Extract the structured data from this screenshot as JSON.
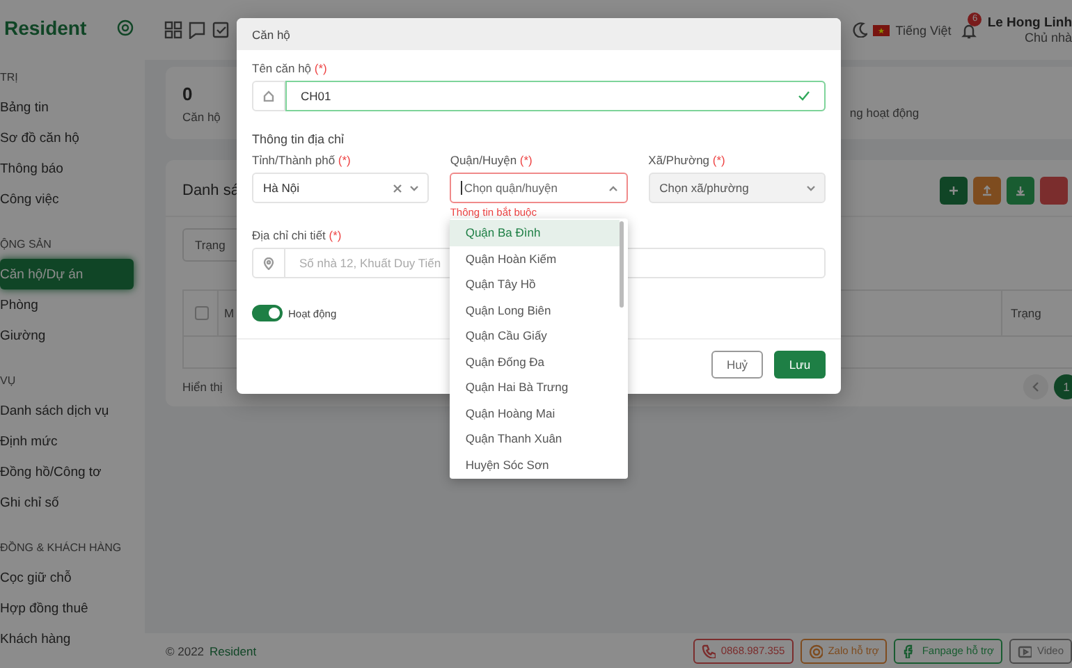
{
  "sidebar": {
    "logo": "Resident",
    "sections": [
      {
        "title": "TRỊ",
        "items": [
          {
            "label": "Bảng tin",
            "selected": false
          },
          {
            "label": "Sơ đồ căn hộ",
            "selected": false
          },
          {
            "label": "Thông báo",
            "selected": false
          },
          {
            "label": "Công việc",
            "selected": false
          }
        ]
      },
      {
        "title": "ỘNG SẢN",
        "items": [
          {
            "label": "Căn hộ/Dự án",
            "selected": true
          },
          {
            "label": "Phòng",
            "selected": false
          },
          {
            "label": "Giường",
            "selected": false
          }
        ]
      },
      {
        "title": "VỤ",
        "items": [
          {
            "label": "Danh sách dịch vụ",
            "selected": false
          },
          {
            "label": "Định mức",
            "selected": false
          },
          {
            "label": "Đồng hồ/Công tơ",
            "selected": false
          },
          {
            "label": "Ghi chỉ số",
            "selected": false
          }
        ]
      },
      {
        "title": "ĐỒNG & KHÁCH HÀNG",
        "items": [
          {
            "label": "Cọc giữ chỗ",
            "selected": false
          },
          {
            "label": "Hợp đồng thuê",
            "selected": false
          },
          {
            "label": "Khách hàng",
            "selected": false
          }
        ]
      }
    ]
  },
  "header": {
    "language": "Tiếng Việt",
    "notification_count": "6",
    "user_name": "Le Hong Linh",
    "user_role": "Chủ nhà"
  },
  "stats": {
    "value": "0",
    "label": "Căn hộ",
    "partial_label": "ng hoạt động"
  },
  "list": {
    "title": "Danh sá",
    "filter": "Trạng",
    "select_all_checked": false,
    "columns": [
      "M",
      "Trạng"
    ],
    "footer_text": "Hiển thị",
    "pagination": [
      {
        "label": "1",
        "selected": true
      }
    ]
  },
  "footer": {
    "copyright": "© 2022",
    "brand": "Resident",
    "buttons": [
      {
        "kind": "phone",
        "label": "0868.987.355"
      },
      {
        "kind": "zalo",
        "label": "Zalo hỗ trợ"
      },
      {
        "kind": "fanpage",
        "label": "Fanpage hỗ trợ"
      },
      {
        "kind": "video",
        "label": "Video"
      }
    ]
  },
  "modal": {
    "title": "Căn hộ",
    "name_field": {
      "label": "Tên căn hộ",
      "required_mark": "(*)",
      "value": "CH01",
      "valid": true
    },
    "address_title": "Thông tin địa chỉ",
    "selects": [
      {
        "label": "Tỉnh/Thành phố",
        "required_mark": "(*)",
        "value": "Hà Nội",
        "clearable": true,
        "open": false,
        "error": false,
        "disabled": false
      },
      {
        "label": "Quận/Huyện",
        "required_mark": "(*)",
        "placeholder": "Chọn quận/huyện",
        "clearable": false,
        "open": true,
        "error": true,
        "error_text": "Thông tin bắt buộc",
        "disabled": false,
        "options": [
          {
            "label": "Quận Ba Đình",
            "selected": true
          },
          {
            "label": "Quận Hoàn Kiếm",
            "selected": false
          },
          {
            "label": "Quận Tây Hồ",
            "selected": false
          },
          {
            "label": "Quận Long Biên",
            "selected": false
          },
          {
            "label": "Quận Cầu Giấy",
            "selected": false
          },
          {
            "label": "Quận Đống Đa",
            "selected": false
          },
          {
            "label": "Quận Hai Bà Trưng",
            "selected": false
          },
          {
            "label": "Quận Hoàng Mai",
            "selected": false
          },
          {
            "label": "Quận Thanh Xuân",
            "selected": false
          },
          {
            "label": "Huyện Sóc Sơn",
            "selected": false
          }
        ]
      },
      {
        "label": "Xã/Phường",
        "required_mark": "(*)",
        "placeholder": "Chọn xã/phường",
        "clearable": false,
        "open": false,
        "error": false,
        "disabled": true
      }
    ],
    "address_field": {
      "label": "Địa chỉ chi tiết",
      "required_mark": "(*)",
      "placeholder": "Số nhà 12, Khuất Duy Tiến"
    },
    "active_toggle": {
      "label": "Hoạt động",
      "on": true
    },
    "buttons": [
      {
        "kind": "cancel",
        "label": "Huỷ"
      },
      {
        "kind": "save",
        "label": "Lưu"
      }
    ]
  }
}
